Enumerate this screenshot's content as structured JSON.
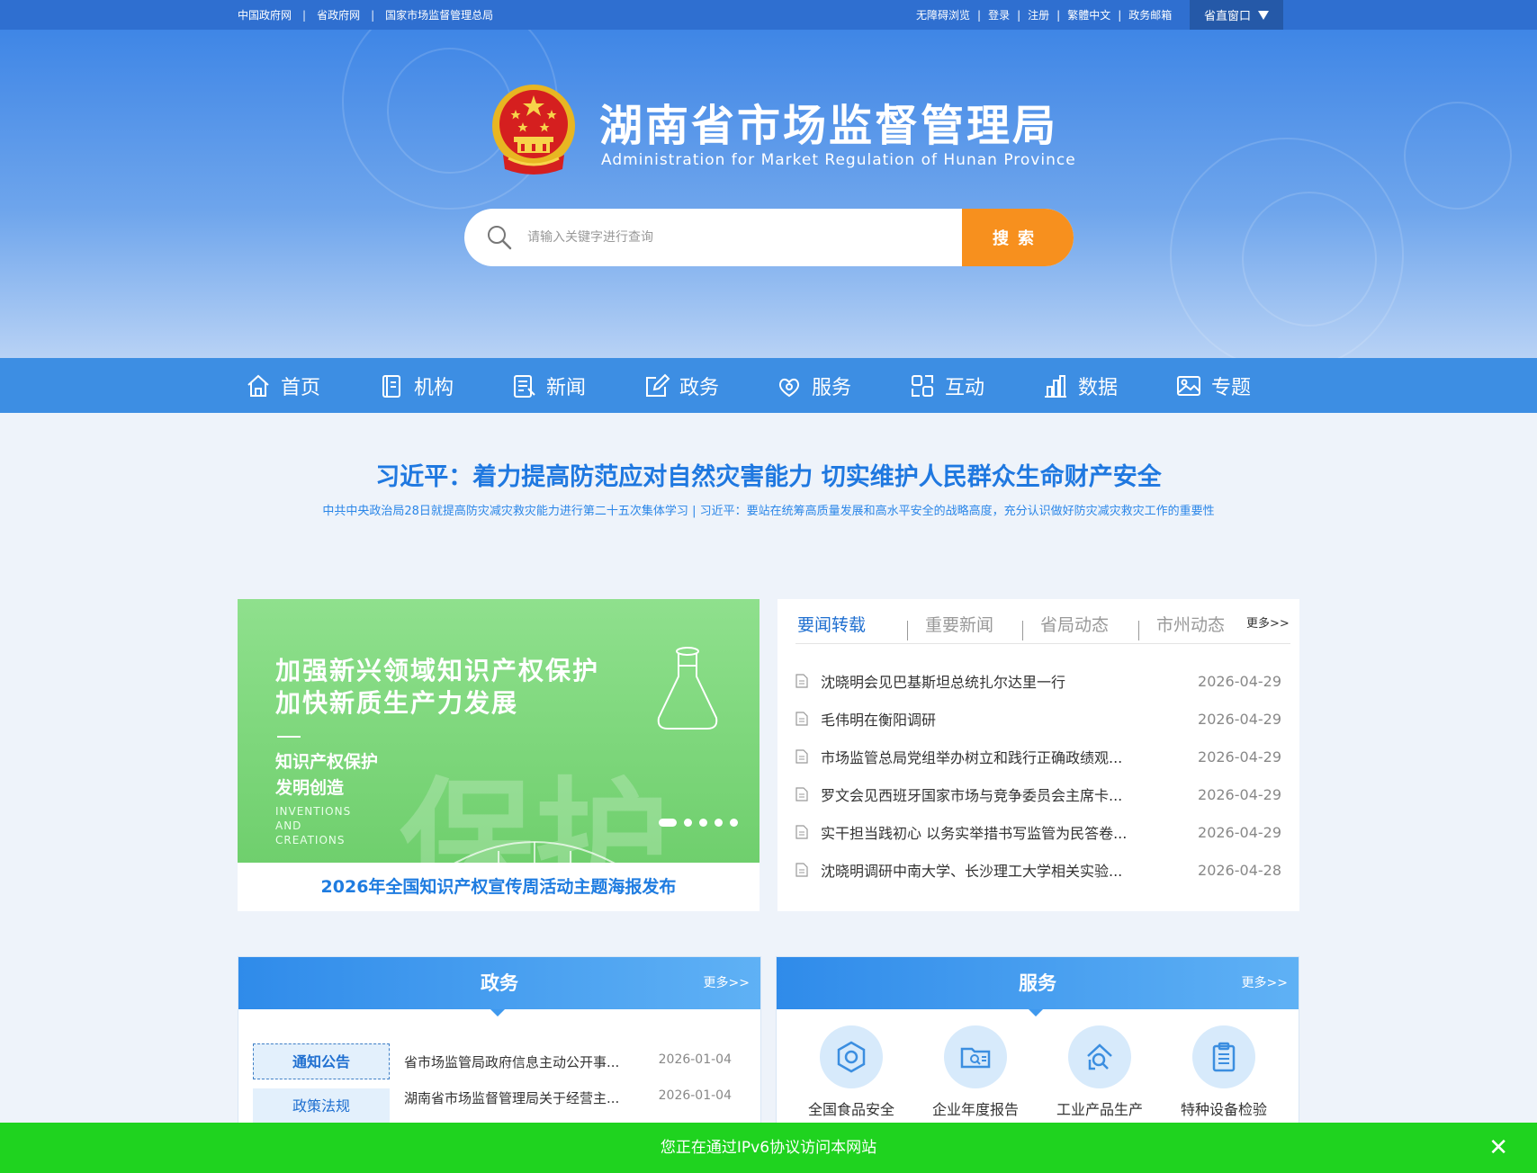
{
  "topbar": {
    "left_links": [
      "中国政府网",
      "省政府网",
      "国家市场监督管理总局"
    ],
    "right_links": [
      "无障碍浏览",
      "登录",
      "注册",
      "繁體中文",
      "政务邮箱"
    ],
    "window_label": "省直窗口"
  },
  "header": {
    "title_cn": "湖南省市场监督管理局",
    "title_en": "Administration for Market Regulation of Hunan Province"
  },
  "search": {
    "placeholder": "请输入关键字进行查询",
    "button": "搜索"
  },
  "nav": [
    {
      "label": "首页",
      "icon": "home-icon"
    },
    {
      "label": "机构",
      "icon": "book-icon"
    },
    {
      "label": "新闻",
      "icon": "news-icon"
    },
    {
      "label": "政务",
      "icon": "edit-icon"
    },
    {
      "label": "服务",
      "icon": "service-icon"
    },
    {
      "label": "互动",
      "icon": "interact-icon"
    },
    {
      "label": "数据",
      "icon": "chart-icon"
    },
    {
      "label": "专题",
      "icon": "image-icon"
    }
  ],
  "headline": {
    "title": "习近平：着力提高防范应对自然灾害能力 切实维护人民群众生命财产安全",
    "subtitle": "中共中央政治局28日就提高防灾减灾救灾能力进行第二十五次集体学习 | 习近平：要站在统筹高质量发展和高水平安全的战略高度，充分认识做好防灾减灾救灾工作的重要性"
  },
  "banner": {
    "line1": "加强新兴领域知识产权保护",
    "line2": "加快新质生产力发展",
    "line3": "知识产权保护",
    "line4": "发明创造",
    "en": [
      "INVENTIONS",
      "AND",
      "CREATIONS"
    ],
    "big_text": "保护",
    "caption": "2026年全国知识产权宣传周活动主题海报发布",
    "slides": 5,
    "active_slide": 1
  },
  "news": {
    "tabs": [
      "要闻转载",
      "重要新闻",
      "省局动态",
      "市州动态"
    ],
    "active_tab": 0,
    "more": "更多>>",
    "items": [
      {
        "title": "沈晓明会见巴基斯坦总统扎尔达里一行",
        "date": "2026-04-29"
      },
      {
        "title": "毛伟明在衡阳调研",
        "date": "2026-04-29"
      },
      {
        "title": "市场监管总局党组举办树立和践行正确政绩观...",
        "date": "2026-04-29"
      },
      {
        "title": "罗文会见西班牙国家市场与竞争委员会主席卡...",
        "date": "2026-04-29"
      },
      {
        "title": "实干担当践初心 以务实举措书写监管为民答卷...",
        "date": "2026-04-29"
      },
      {
        "title": "沈晓明调研中南大学、长沙理工大学相关实验...",
        "date": "2026-04-28"
      }
    ]
  },
  "gov_panel": {
    "title": "政务",
    "more": "更多>>",
    "tabs": [
      "通知公告",
      "政策法规"
    ],
    "items": [
      {
        "title": "省市场监管局政府信息主动公开事...",
        "date": "2026-01-04"
      },
      {
        "title": "湖南省市场监督管理局关于经营主...",
        "date": "2026-01-04"
      }
    ]
  },
  "service_panel": {
    "title": "服务",
    "more": "更多>>",
    "items": [
      {
        "label": "全国食品安全",
        "icon": "hexagon-icon"
      },
      {
        "label": "企业年度报告",
        "icon": "folder-search-icon"
      },
      {
        "label": "工业产品生产",
        "icon": "factory-icon"
      },
      {
        "label": "特种设备检验",
        "icon": "clipboard-icon"
      }
    ]
  },
  "ipv6_bar": {
    "text": "您正在通过IPv6协议访问本网站",
    "close": "✕"
  },
  "colors": {
    "topbar": "#2f6fd0",
    "nav": "#3d8ee3",
    "accent_orange": "#f7901e",
    "headline_blue": "#1f78e0",
    "ipv6_green": "#1fd31f"
  }
}
